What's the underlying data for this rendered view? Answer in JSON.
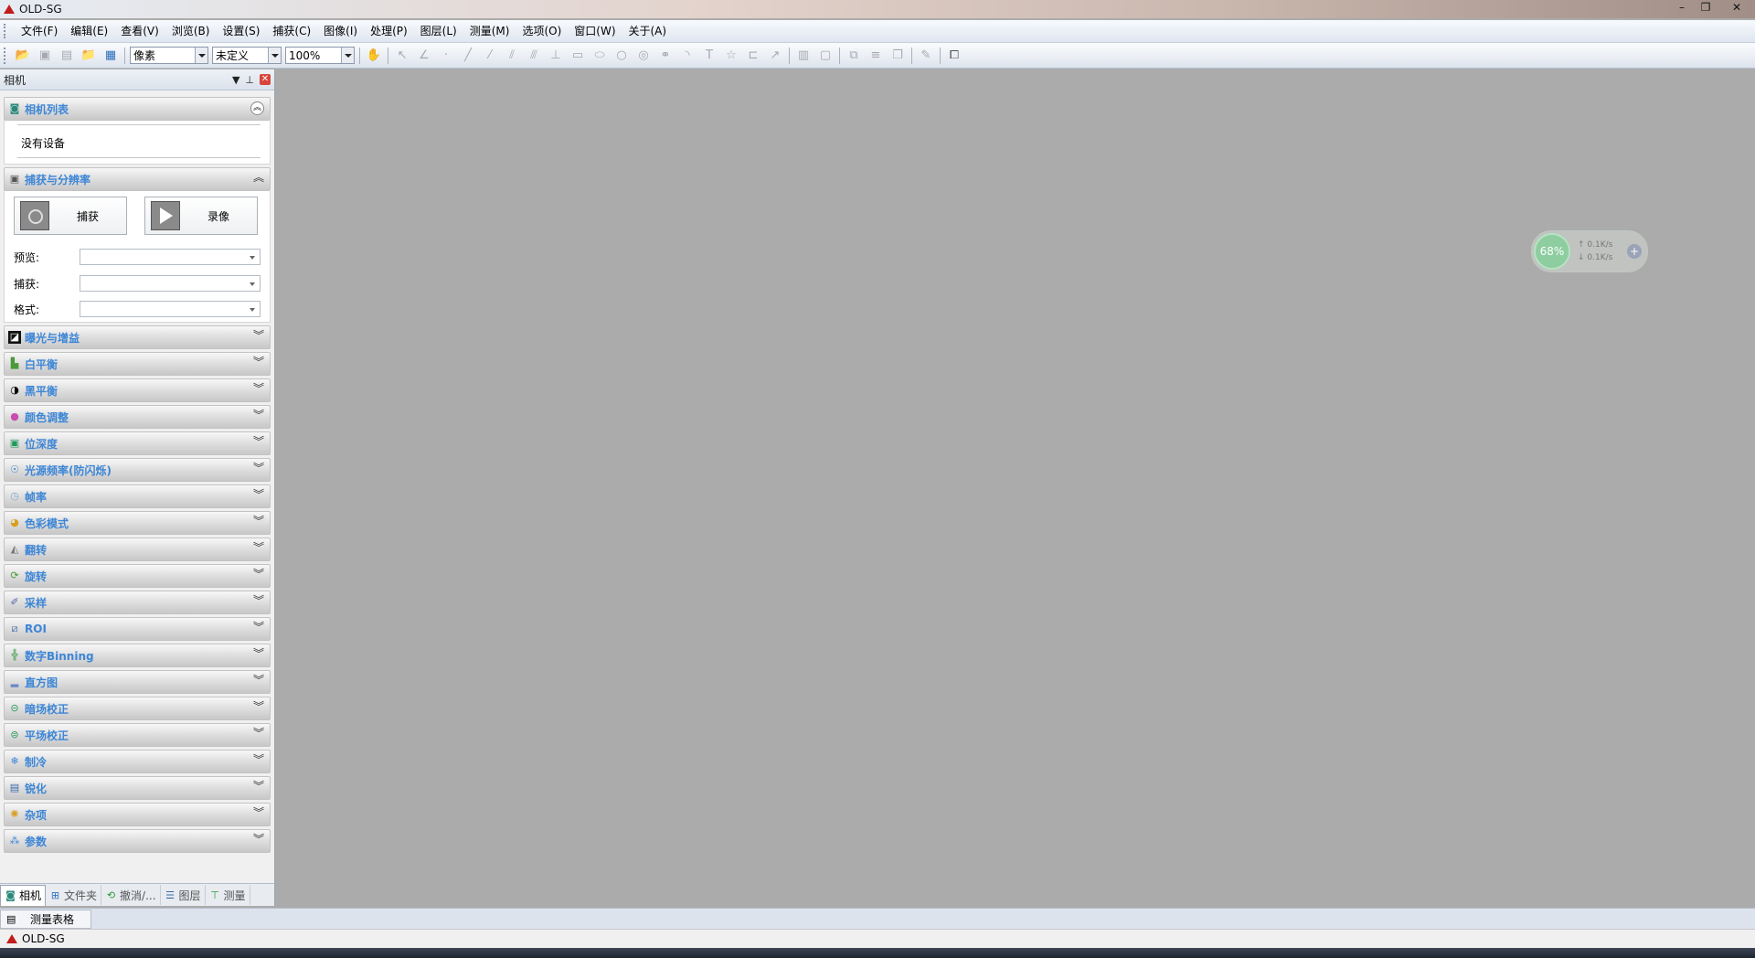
{
  "window": {
    "title": "OLD-SG",
    "minimize": "–",
    "maximize": "❐",
    "close": "✕"
  },
  "menu": [
    "文件(F)",
    "编辑(E)",
    "查看(V)",
    "浏览(B)",
    "设置(S)",
    "捕获(C)",
    "图像(I)",
    "处理(P)",
    "图层(L)",
    "测量(M)",
    "选项(O)",
    "窗口(W)",
    "关于(A)"
  ],
  "toolbar": {
    "unit": "像素",
    "calibration": "未定义",
    "zoom": "100%"
  },
  "panel": {
    "title": "相机",
    "pin": "📌",
    "sections": {
      "camera_list": {
        "label": "相机列表",
        "empty": "没有设备"
      },
      "capture": {
        "label": "捕获与分辨率",
        "capture_btn": "捕获",
        "record_btn": "录像",
        "preview_label": "预览:",
        "capture_label": "捕获:",
        "format_label": "格式:"
      },
      "collapsed": [
        {
          "label": "曝光与增益",
          "icon": "exposure-icon"
        },
        {
          "label": "白平衡",
          "icon": "white-balance-icon"
        },
        {
          "label": "黑平衡",
          "icon": "black-balance-icon"
        },
        {
          "label": "颜色调整",
          "icon": "color-adjust-icon"
        },
        {
          "label": "位深度",
          "icon": "bit-depth-icon"
        },
        {
          "label": "光源频率(防闪烁)",
          "icon": "light-frequency-icon"
        },
        {
          "label": "帧率",
          "icon": "frame-rate-icon"
        },
        {
          "label": "色彩模式",
          "icon": "color-mode-icon"
        },
        {
          "label": "翻转",
          "icon": "flip-icon"
        },
        {
          "label": "旋转",
          "icon": "rotate-icon"
        },
        {
          "label": "采样",
          "icon": "sampling-icon"
        },
        {
          "label": "ROI",
          "icon": "roi-icon"
        },
        {
          "label": "数字Binning",
          "icon": "binning-icon"
        },
        {
          "label": "直方图",
          "icon": "histogram-icon"
        },
        {
          "label": "暗场校正",
          "icon": "dark-field-icon"
        },
        {
          "label": "平场校正",
          "icon": "flat-field-icon"
        },
        {
          "label": "制冷",
          "icon": "cooling-icon"
        },
        {
          "label": "锐化",
          "icon": "sharpen-icon"
        },
        {
          "label": "杂项",
          "icon": "misc-icon"
        },
        {
          "label": "参数",
          "icon": "parameters-icon"
        }
      ]
    },
    "tabs": [
      "相机",
      "文件夹",
      "撤消/...",
      "图层",
      "测量"
    ]
  },
  "bottom": {
    "measure_tab": "测量表格",
    "status_title": "OLD-SG"
  },
  "network_widget": {
    "percent": "68%",
    "up": "↑ 0.1K/s",
    "down": "↓ 0.1K/s",
    "plus": "+"
  },
  "colors": {
    "accent": "#3d86d6",
    "workspace": "#ababab",
    "close": "#d8453b"
  }
}
